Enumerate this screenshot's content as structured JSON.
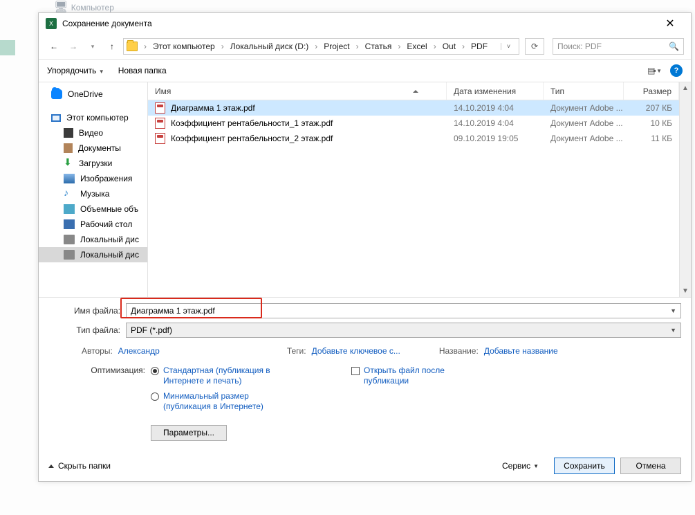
{
  "background": {
    "peek": "Компьютер"
  },
  "dialog": {
    "title": "Сохранение документа"
  },
  "nav": {
    "crumbs": [
      "Этот компьютер",
      "Локальный диск (D:)",
      "Project",
      "Статья",
      "Excel",
      "Out",
      "PDF"
    ],
    "search_placeholder": "Поиск: PDF"
  },
  "toolbar": {
    "organize": "Упорядочить",
    "new_folder": "Новая папка"
  },
  "sidebar": {
    "onedrive": "OneDrive",
    "this_pc": "Этот компьютер",
    "items": [
      "Видео",
      "Документы",
      "Загрузки",
      "Изображения",
      "Музыка",
      "Объемные объ",
      "Рабочий стол",
      "Локальный дис",
      "Локальный дис"
    ]
  },
  "columns": {
    "name": "Имя",
    "date": "Дата изменения",
    "type": "Тип",
    "size": "Размер"
  },
  "files": [
    {
      "name": "Диаграмма 1 этаж.pdf",
      "date": "14.10.2019 4:04",
      "type": "Документ Adobe ...",
      "size": "207 КБ"
    },
    {
      "name": "Коэффициент рентабельности_1 этаж.pdf",
      "date": "14.10.2019 4:04",
      "type": "Документ Adobe ...",
      "size": "10 КБ"
    },
    {
      "name": "Коэффициент рентабельности_2 этаж.pdf",
      "date": "09.10.2019 19:05",
      "type": "Документ Adobe ...",
      "size": "11 КБ"
    }
  ],
  "fields": {
    "filename_label": "Имя файла:",
    "filename_value": "Диаграмма 1 этаж.pdf",
    "filetype_label": "Тип файла:",
    "filetype_value": "PDF (*.pdf)"
  },
  "meta": {
    "authors_label": "Авторы:",
    "authors_value": "Александр",
    "tags_label": "Теги:",
    "tags_value": "Добавьте ключевое с...",
    "title_label": "Название:",
    "title_value": "Добавьте название"
  },
  "options": {
    "optimization_label": "Оптимизация:",
    "radio_standard": "Стандартная (публикация в Интернете и печать)",
    "radio_minimal": "Минимальный размер (публикация в Интернете)",
    "params_button": "Параметры...",
    "open_after": "Открыть файл после публикации"
  },
  "footer": {
    "hide_folders": "Скрыть папки",
    "tools": "Сервис",
    "save": "Сохранить",
    "cancel": "Отмена"
  }
}
